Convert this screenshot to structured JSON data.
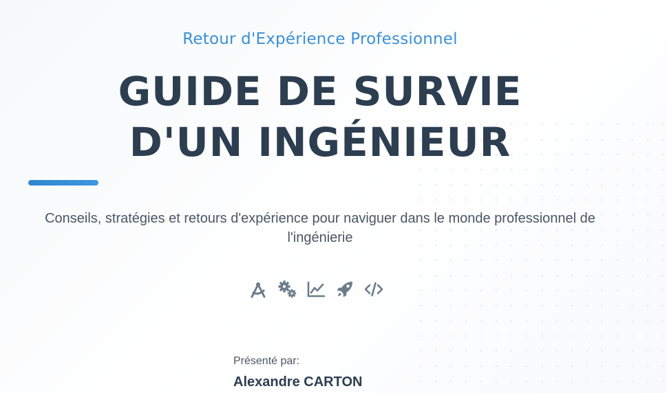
{
  "header": {
    "subtitle": "Retour d'Expérience Professionnel",
    "title_line_1": "GUIDE DE SURVIE",
    "title_line_2": "D'UN INGÉNIEUR"
  },
  "description": "Conseils, stratégies et retours d'expérience pour naviguer dans le monde professionnel de l'ingénierie",
  "icons": [
    "drafting-compass-icon",
    "gears-icon",
    "chart-line-icon",
    "rocket-icon",
    "code-icon"
  ],
  "presenter": {
    "label": "Présenté par:",
    "name": "Alexandre CARTON"
  },
  "colors": {
    "accent": "#3a90d6",
    "title": "#2c3e50",
    "text": "#4a5563",
    "icon": "#6b7c8a"
  }
}
